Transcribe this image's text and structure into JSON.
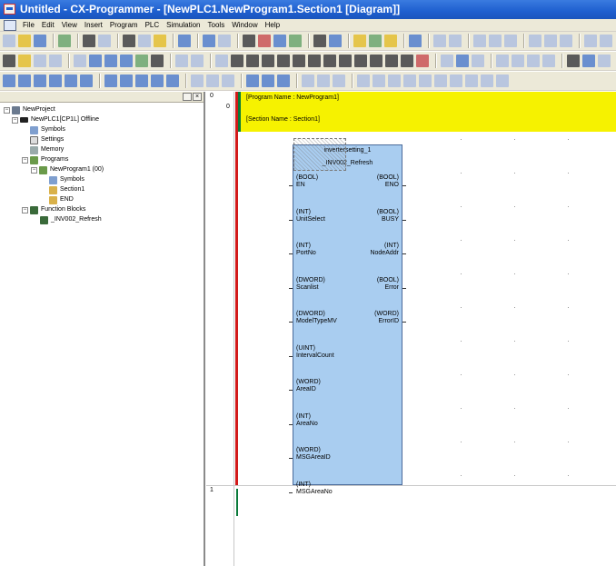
{
  "window": {
    "title": "Untitled - CX-Programmer - [NewPLC1.NewProgram1.Section1 [Diagram]]"
  },
  "menu": [
    "File",
    "Edit",
    "View",
    "Insert",
    "Program",
    "PLC",
    "Simulation",
    "Tools",
    "Window",
    "Help"
  ],
  "tree": {
    "project": "NewProject",
    "plc": "NewPLC1[CP1L] Offline",
    "symbols": "Symbols",
    "settings": "Settings",
    "memory": "Memory",
    "programs": "Programs",
    "program": "NewProgram1 (00)",
    "program_symbols": "Symbols",
    "section": "Section1",
    "end": "END",
    "function_blocks": "Function Blocks",
    "fb_item": "_INV002_Refresh"
  },
  "gutter": {
    "rung0": "0",
    "step0": "0",
    "rung1": "1"
  },
  "diagram": {
    "program_name": "[Program Name : NewProgram1]",
    "section_name": "[Section Name : Section1]"
  },
  "fb": {
    "instance": "invertersetting_1",
    "name": "_INV002_Refresh",
    "inputs": [
      {
        "type": "(BOOL)",
        "name": "EN"
      },
      {
        "type": "(INT)",
        "name": "UnitSelect"
      },
      {
        "type": "(INT)",
        "name": "PortNo"
      },
      {
        "type": "(DWORD)",
        "name": "Scanlist"
      },
      {
        "type": "(DWORD)",
        "name": "ModelTypeMV"
      },
      {
        "type": "(UINT)",
        "name": "IntervalCount"
      },
      {
        "type": "(WORD)",
        "name": "AreaID"
      },
      {
        "type": "(INT)",
        "name": "AreaNo"
      },
      {
        "type": "(WORD)",
        "name": "MSGAreaID"
      },
      {
        "type": "(INT)",
        "name": "MSGAreaNo"
      }
    ],
    "outputs": [
      {
        "type": "(BOOL)",
        "name": "ENO"
      },
      {
        "type": "(BOOL)",
        "name": "BUSY"
      },
      {
        "type": "(INT)",
        "name": "NodeAddr"
      },
      {
        "type": "(BOOL)",
        "name": "Error"
      },
      {
        "type": "(WORD)",
        "name": "ErrorID"
      }
    ]
  },
  "colors": {
    "title_bar": "#1e5fcf",
    "name_band": "#f6f200",
    "fb_fill": "#a9cdf0",
    "left_rail": "#d21a1a",
    "rung_marker": "#0a7a3a"
  }
}
